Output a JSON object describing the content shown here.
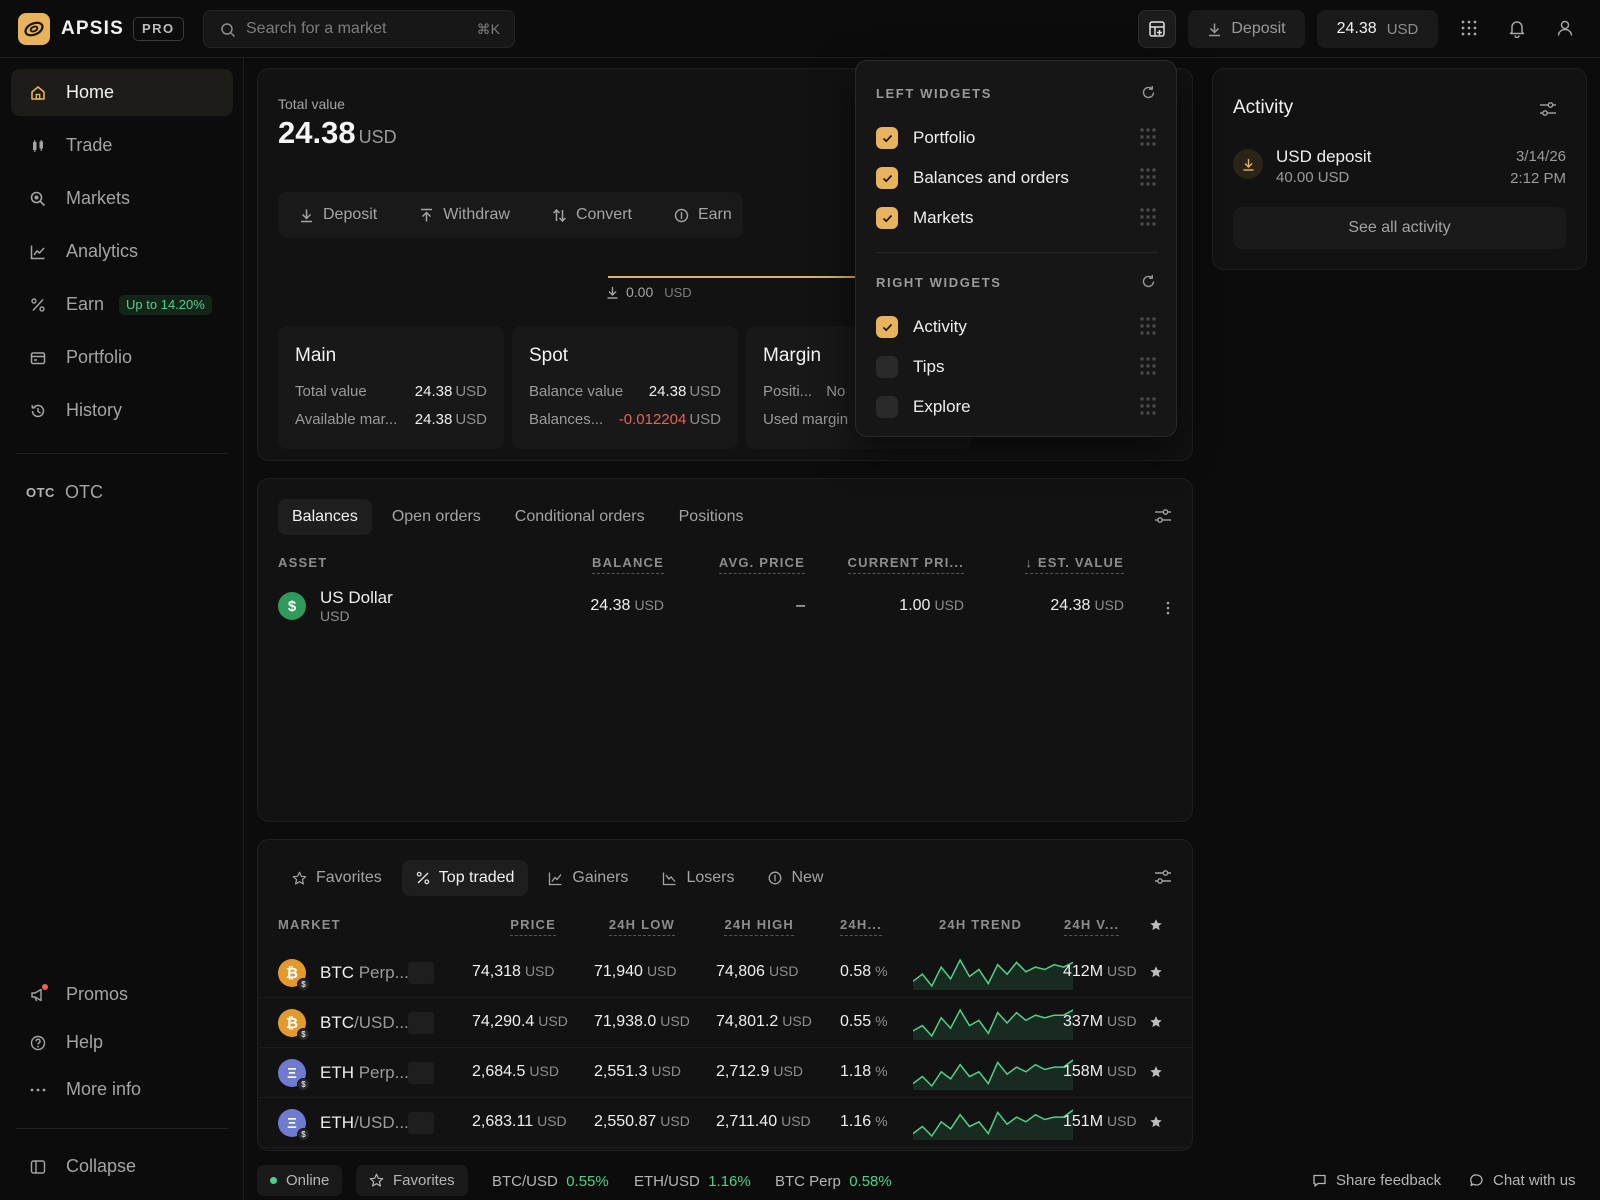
{
  "header": {
    "brand": "APSIS",
    "badge": "PRO",
    "search_placeholder": "Search for a market",
    "search_shortcut": "⌘K",
    "deposit_label": "Deposit",
    "balance_value": "24.38",
    "balance_currency": "USD"
  },
  "sidebar": {
    "items": [
      {
        "label": "Home",
        "icon": "home-icon"
      },
      {
        "label": "Trade",
        "icon": "candles-icon"
      },
      {
        "label": "Markets",
        "icon": "magnifier-icon"
      },
      {
        "label": "Analytics",
        "icon": "chart-icon"
      },
      {
        "label": "Earn",
        "icon": "percent-icon",
        "badge": "Up to 14.20%"
      },
      {
        "label": "Portfolio",
        "icon": "wallet-icon"
      },
      {
        "label": "History",
        "icon": "history-icon"
      }
    ],
    "otc_tag": "OTC",
    "otc_label": "OTC",
    "bottom": [
      {
        "label": "Promos",
        "icon": "megaphone-icon"
      },
      {
        "label": "Help",
        "icon": "help-icon"
      },
      {
        "label": "More info",
        "icon": "dots-icon"
      }
    ],
    "collapse_label": "Collapse"
  },
  "portfolio": {
    "total_label": "Total value",
    "total_value": "24.38",
    "currency": "USD",
    "actions": [
      "Deposit",
      "Withdraw",
      "Convert",
      "Earn"
    ],
    "chart_zero_value": "0.00",
    "chart_zero_currency": "USD",
    "accounts": [
      {
        "title": "Main",
        "rows": [
          {
            "k": "Total value",
            "v": "24.38",
            "cur": "USD"
          },
          {
            "k": "Available mar...",
            "v": "24.38",
            "cur": "USD"
          }
        ]
      },
      {
        "title": "Spot",
        "rows": [
          {
            "k": "Balance value",
            "v": "24.38",
            "cur": "USD"
          },
          {
            "k": "Balances...",
            "v": "-0.012204",
            "cur": "USD"
          }
        ]
      },
      {
        "title": "Margin",
        "rows": [
          {
            "k": "Positi...",
            "v": "No",
            "cur": ""
          },
          {
            "k": "Used margin",
            "v": "",
            "cur": ""
          }
        ]
      }
    ]
  },
  "balances": {
    "tabs": [
      "Balances",
      "Open orders",
      "Conditional orders",
      "Positions"
    ],
    "columns": [
      "ASSET",
      "BALANCE",
      "AVG. PRICE",
      "CURRENT PRI...",
      "↓ EST. VALUE"
    ],
    "rows": [
      {
        "icon": "$",
        "name": "US Dollar",
        "code": "USD",
        "balance": "24.38",
        "avg_price": "–",
        "current_price": "1.00",
        "est_value": "24.38",
        "cur": "USD"
      }
    ]
  },
  "markets": {
    "tabs": [
      "Favorites",
      "Top traded",
      "Gainers",
      "Losers",
      "New"
    ],
    "columns": [
      "MARKET",
      "PRICE",
      "24H LOW",
      "24H HIGH",
      "24H...",
      "24H TREND",
      "24H V..."
    ],
    "rows": [
      {
        "base": "BTC",
        "pair": " Perp...",
        "coin": "bitcoin",
        "price": "74,318",
        "low": "71,940",
        "high": "74,806",
        "change": "0.58",
        "volume": "412M",
        "cur": "USD",
        "pct": "%",
        "trend": [
          6,
          9,
          4,
          12,
          7,
          15,
          8,
          11,
          5,
          13,
          9,
          14,
          10,
          12,
          11,
          13,
          12,
          14
        ]
      },
      {
        "base": "BTC",
        "pair": "/USD...",
        "coin": "bitcoin",
        "price": "74,290.4",
        "low": "71,938.0",
        "high": "74,801.2",
        "change": "0.55",
        "volume": "337M",
        "cur": "USD",
        "pct": "%",
        "trend": [
          6,
          8,
          4,
          11,
          7,
          14,
          8,
          10,
          5,
          13,
          9,
          13,
          10,
          12,
          11,
          12,
          12,
          14
        ]
      },
      {
        "base": "ETH",
        "pair": " Perp...",
        "coin": "ethereum",
        "price": "2,684.5",
        "low": "2,551.3",
        "high": "2,712.9",
        "change": "1.18",
        "volume": "158M",
        "cur": "USD",
        "pct": "%",
        "trend": [
          5,
          8,
          4,
          10,
          7,
          13,
          8,
          10,
          5,
          14,
          9,
          12,
          10,
          13,
          11,
          12,
          12,
          15
        ]
      },
      {
        "base": "ETH",
        "pair": "/USD...",
        "coin": "ethereum",
        "price": "2,683.11",
        "low": "2,550.87",
        "high": "2,711.40",
        "change": "1.16",
        "volume": "151M",
        "cur": "USD",
        "pct": "%",
        "trend": [
          5,
          8,
          4,
          10,
          7,
          13,
          8,
          10,
          5,
          14,
          9,
          12,
          10,
          13,
          11,
          12,
          12,
          15
        ]
      }
    ]
  },
  "activity": {
    "title": "Activity",
    "items": [
      {
        "title": "USD deposit",
        "amount": "40.00 USD",
        "date": "3/14/26",
        "time": "2:12 PM"
      }
    ],
    "see_all": "See all activity"
  },
  "widgets_popover": {
    "left_heading": "LEFT WIDGETS",
    "left": [
      {
        "label": "Portfolio",
        "checked": true
      },
      {
        "label": "Balances and orders",
        "checked": true
      },
      {
        "label": "Markets",
        "checked": true
      }
    ],
    "right_heading": "RIGHT WIDGETS",
    "right": [
      {
        "label": "Activity",
        "checked": true
      },
      {
        "label": "Tips",
        "checked": false
      },
      {
        "label": "Explore",
        "checked": false
      }
    ]
  },
  "statusbar": {
    "online": "Online",
    "favorites": "Favorites",
    "tickers": [
      {
        "pair": "BTC/USD",
        "change": "0.55%"
      },
      {
        "pair": "ETH/USD",
        "change": "1.16%"
      },
      {
        "pair": "BTC Perp",
        "change": "0.58%"
      }
    ],
    "share_feedback": "Share feedback",
    "chat": "Chat with us"
  },
  "colors": {
    "accent": "#e7b35d",
    "positive": "#4fd18b",
    "negative": "#ef5f56",
    "bitcoin": "#e39a2c",
    "ethereum": "#6f7bd0",
    "usd": "#2f9a5a"
  }
}
